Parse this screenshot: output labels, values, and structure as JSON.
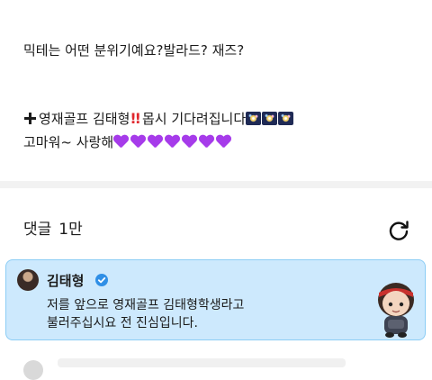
{
  "post": {
    "line1": "믹테는 어떤 분위기예요?발라드? 재즈?",
    "line2_text": "영재골프 김태형",
    "line2_tail": "몹시 기다려집니다",
    "line3_text": "고마워~ 사랑해",
    "icons": {
      "plus": "heavy-plus-icon",
      "double_exclamation": "double-exclamation-icon",
      "firework": "firework-icon",
      "heart": "purple-heart-icon"
    },
    "heart_color": "#a63bea"
  },
  "comments": {
    "title": "댓글",
    "count": "1만",
    "refresh_icon": "refresh-icon"
  },
  "pinned_comment": {
    "author": "김태형",
    "verified_icon": "verified-badge-icon",
    "line1": "저를 앞으로 영재골프 김태형학생라고",
    "line2": "불러주십시요 전 진심입니다.",
    "background": "#cde9fd",
    "border": "#8ccdf5"
  }
}
